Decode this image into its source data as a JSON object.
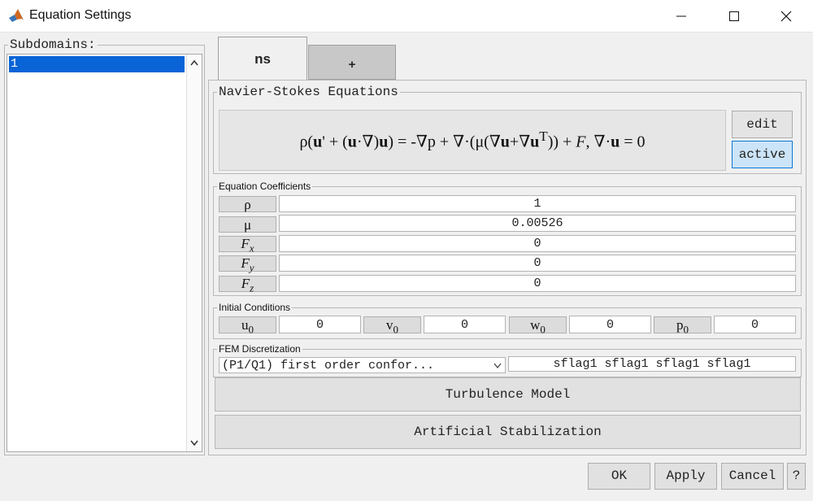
{
  "window": {
    "title": "Equation Settings",
    "icon": "matlab-icon",
    "controls": [
      "minimize-icon",
      "maximize-icon",
      "close-icon"
    ]
  },
  "subdomains": {
    "legend": "Subdomains:",
    "items": [
      "1"
    ],
    "selected": "1"
  },
  "tabs": [
    {
      "label": "ns",
      "active": true
    },
    {
      "label": "+",
      "active": false
    }
  ],
  "equation": {
    "legend": "Navier-Stokes Equations",
    "formula_text": "ρ(u' + (u·∇)u) = -∇p + ∇·(μ(∇u+∇uT)) + F, ∇·u = 0",
    "edit_label": "edit",
    "active_label": "active"
  },
  "coefficients": {
    "legend": "Equation Coefficients",
    "rows": [
      {
        "symbol": "ρ",
        "value": "1"
      },
      {
        "symbol": "μ",
        "value": "0.00526"
      },
      {
        "symbol": "Fx",
        "value": "0"
      },
      {
        "symbol": "Fy",
        "value": "0"
      },
      {
        "symbol": "Fz",
        "value": "0"
      }
    ]
  },
  "initial_conditions": {
    "legend": "Initial Conditions",
    "items": [
      {
        "symbol": "u0",
        "value": "0"
      },
      {
        "symbol": "v0",
        "value": "0"
      },
      {
        "symbol": "w0",
        "value": "0"
      },
      {
        "symbol": "p0",
        "value": "0"
      }
    ]
  },
  "fem": {
    "legend": "FEM Discretization",
    "selected": "(P1/Q1) first order confor...",
    "flags": "sflag1 sflag1 sflag1 sflag1"
  },
  "turbulence_label": "Turbulence Model",
  "stabilization_label": "Artificial Stabilization",
  "footer": {
    "ok": "OK",
    "apply": "Apply",
    "cancel": "Cancel",
    "help": "?"
  },
  "colors": {
    "selection": "#0a64d7",
    "active_button": "#cce4f7",
    "active_border": "#0a78d7"
  }
}
